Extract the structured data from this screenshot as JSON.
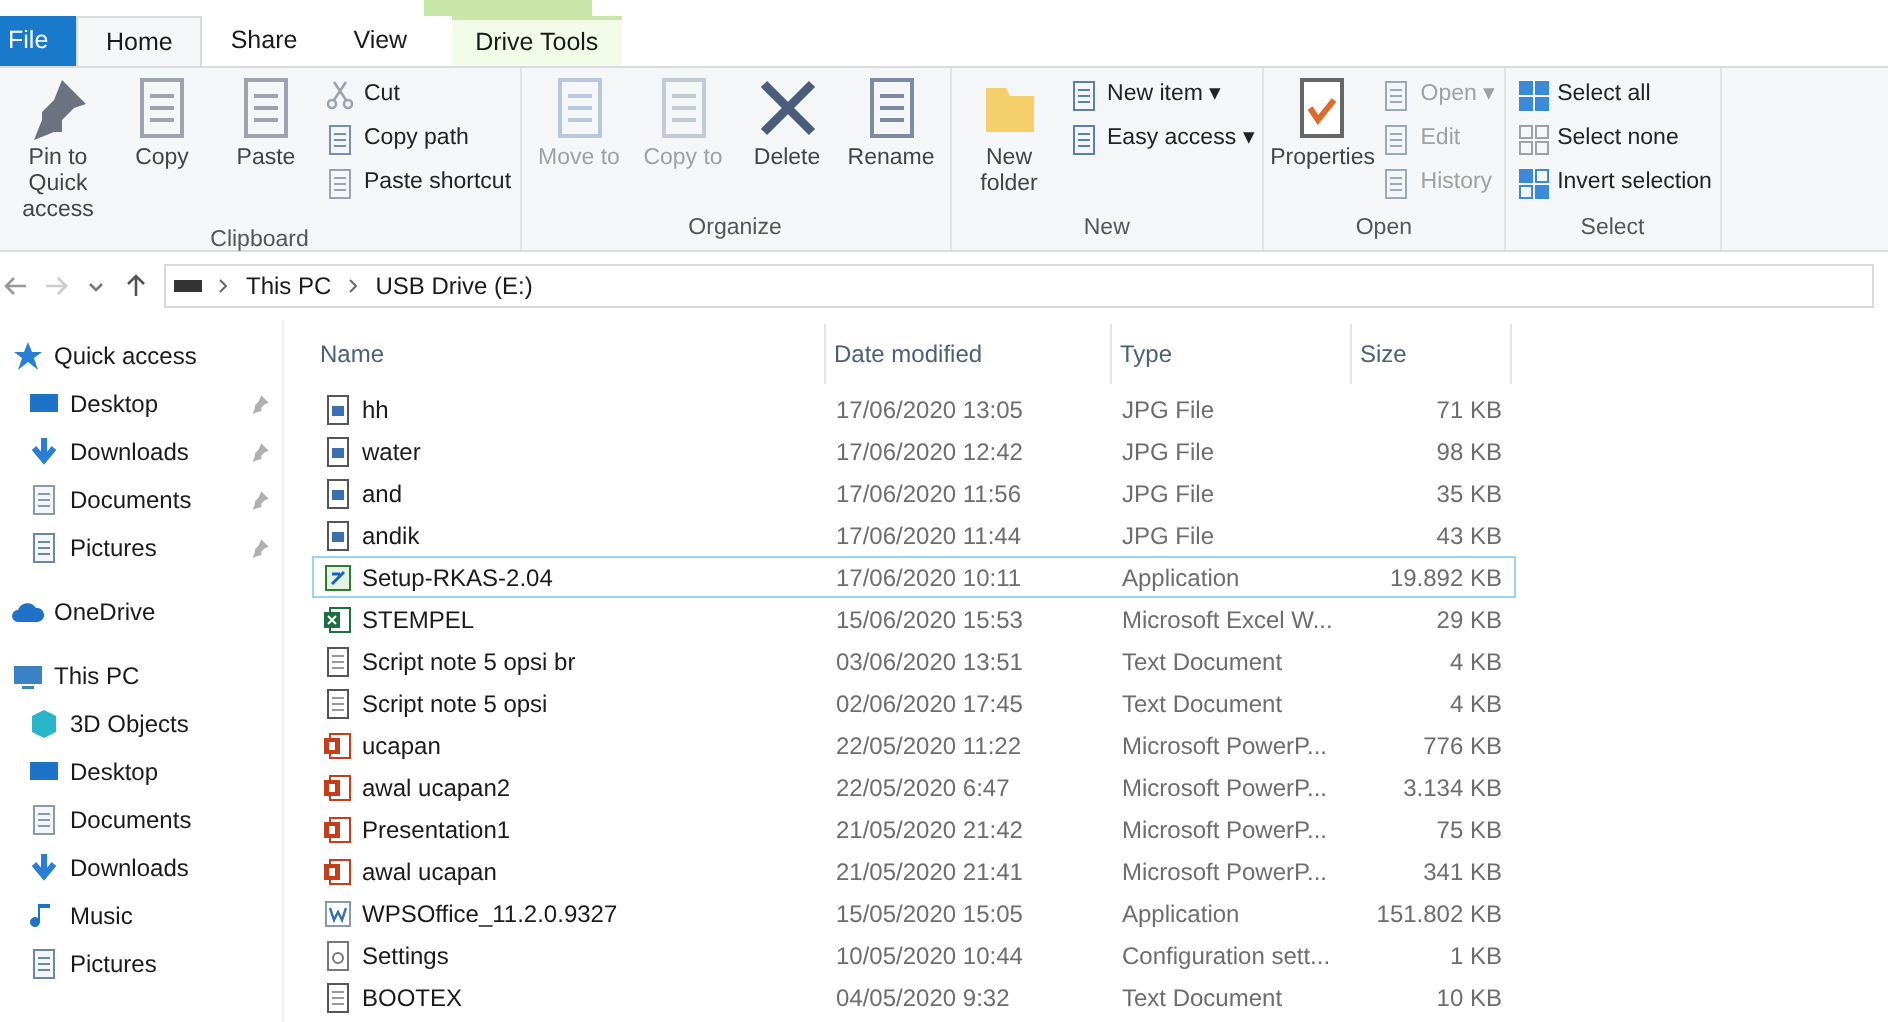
{
  "ribbon_tabs": [
    {
      "label": "File",
      "kind": "file",
      "selected": false
    },
    {
      "label": "Home",
      "kind": "tab",
      "selected": true
    },
    {
      "label": "Share",
      "kind": "tab",
      "selected": false
    },
    {
      "label": "View",
      "kind": "tab",
      "selected": false
    },
    {
      "label": "Drive Tools",
      "kind": "context",
      "selected": false
    }
  ],
  "ribbon_groups": [
    {
      "title": "Clipboard",
      "large": [
        {
          "label": "Pin to Quick access",
          "disabled": false
        },
        {
          "label": "Copy",
          "disabled": false
        },
        {
          "label": "Paste",
          "disabled": false
        }
      ],
      "small": [
        {
          "label": "Cut",
          "disabled": false
        },
        {
          "label": "Copy path",
          "disabled": false
        },
        {
          "label": "Paste shortcut",
          "disabled": false
        }
      ]
    },
    {
      "title": "Organize",
      "large": [
        {
          "label": "Move to",
          "disabled": true
        },
        {
          "label": "Copy to",
          "disabled": true
        },
        {
          "label": "Delete",
          "disabled": false
        },
        {
          "label": "Rename",
          "disabled": false
        }
      ]
    },
    {
      "title": "New",
      "large": [
        {
          "label": "New folder",
          "disabled": false
        }
      ],
      "small": [
        {
          "label": "New item ▾",
          "disabled": false
        },
        {
          "label": "Easy access ▾",
          "disabled": false
        }
      ]
    },
    {
      "title": "Open",
      "large": [
        {
          "label": "Properties",
          "disabled": false
        }
      ],
      "small": [
        {
          "label": "Open ▾",
          "disabled": true
        },
        {
          "label": "Edit",
          "disabled": true
        },
        {
          "label": "History",
          "disabled": true
        }
      ]
    },
    {
      "title": "Select",
      "small": [
        {
          "label": "Select all",
          "disabled": false
        },
        {
          "label": "Select none",
          "disabled": false
        },
        {
          "label": "Invert selection",
          "disabled": false
        }
      ]
    }
  ],
  "address_bar": {
    "path": [
      "This PC",
      "USB Drive (E:)"
    ]
  },
  "sidebar": {
    "items": [
      {
        "label": "Quick access",
        "children": [
          {
            "label": "Desktop",
            "pinned": true
          },
          {
            "label": "Downloads",
            "pinned": true
          },
          {
            "label": "Documents",
            "pinned": true
          },
          {
            "label": "Pictures",
            "pinned": true
          }
        ]
      },
      {
        "label": "OneDrive"
      },
      {
        "label": "This PC",
        "children": [
          {
            "label": "3D Objects",
            "pinned": false
          },
          {
            "label": "Desktop",
            "pinned": false
          },
          {
            "label": "Documents",
            "pinned": false
          },
          {
            "label": "Downloads",
            "pinned": false
          },
          {
            "label": "Music",
            "pinned": false
          },
          {
            "label": "Pictures",
            "pinned": false
          }
        ]
      }
    ]
  },
  "file_list": {
    "columns": [
      "Name",
      "Date modified",
      "Type",
      "Size"
    ],
    "rows": [
      {
        "name": "hh",
        "date": "17/06/2020 13:05",
        "type": "JPG File",
        "size": "71 KB",
        "kind": "image",
        "focused": false
      },
      {
        "name": "water",
        "date": "17/06/2020 12:42",
        "type": "JPG File",
        "size": "98 KB",
        "kind": "image",
        "focused": false
      },
      {
        "name": "and",
        "date": "17/06/2020 11:56",
        "type": "JPG File",
        "size": "35 KB",
        "kind": "image",
        "focused": false
      },
      {
        "name": "andik",
        "date": "17/06/2020 11:44",
        "type": "JPG File",
        "size": "43 KB",
        "kind": "image",
        "focused": false
      },
      {
        "name": "Setup-RKAS-2.04",
        "date": "17/06/2020 10:11",
        "type": "Application",
        "size": "19.892 KB",
        "kind": "setup",
        "focused": true
      },
      {
        "name": "STEMPEL",
        "date": "15/06/2020 15:53",
        "type": "Microsoft Excel W...",
        "size": "29 KB",
        "kind": "excel",
        "focused": false
      },
      {
        "name": "Script note 5 opsi br",
        "date": "03/06/2020 13:51",
        "type": "Text Document",
        "size": "4 KB",
        "kind": "text",
        "focused": false
      },
      {
        "name": "Script note 5 opsi",
        "date": "02/06/2020 17:45",
        "type": "Text Document",
        "size": "4 KB",
        "kind": "text",
        "focused": false
      },
      {
        "name": "ucapan",
        "date": "22/05/2020 11:22",
        "type": "Microsoft PowerP...",
        "size": "776 KB",
        "kind": "powerpoint",
        "focused": false
      },
      {
        "name": "awal ucapan2",
        "date": "22/05/2020 6:47",
        "type": "Microsoft PowerP...",
        "size": "3.134 KB",
        "kind": "powerpoint",
        "focused": false
      },
      {
        "name": "Presentation1",
        "date": "21/05/2020 21:42",
        "type": "Microsoft PowerP...",
        "size": "75 KB",
        "kind": "powerpoint",
        "focused": false
      },
      {
        "name": "awal ucapan",
        "date": "21/05/2020 21:41",
        "type": "Microsoft PowerP...",
        "size": "341 KB",
        "kind": "powerpoint",
        "focused": false
      },
      {
        "name": "WPSOffice_11.2.0.9327",
        "date": "15/05/2020 15:05",
        "type": "Application",
        "size": "151.802 KB",
        "kind": "wps",
        "focused": false
      },
      {
        "name": "Settings",
        "date": "10/05/2020 10:44",
        "type": "Configuration sett...",
        "size": "1 KB",
        "kind": "settings",
        "focused": false
      },
      {
        "name": "BOOTEX",
        "date": "04/05/2020 9:32",
        "type": "Text Document",
        "size": "10 KB",
        "kind": "text",
        "focused": false
      }
    ]
  }
}
